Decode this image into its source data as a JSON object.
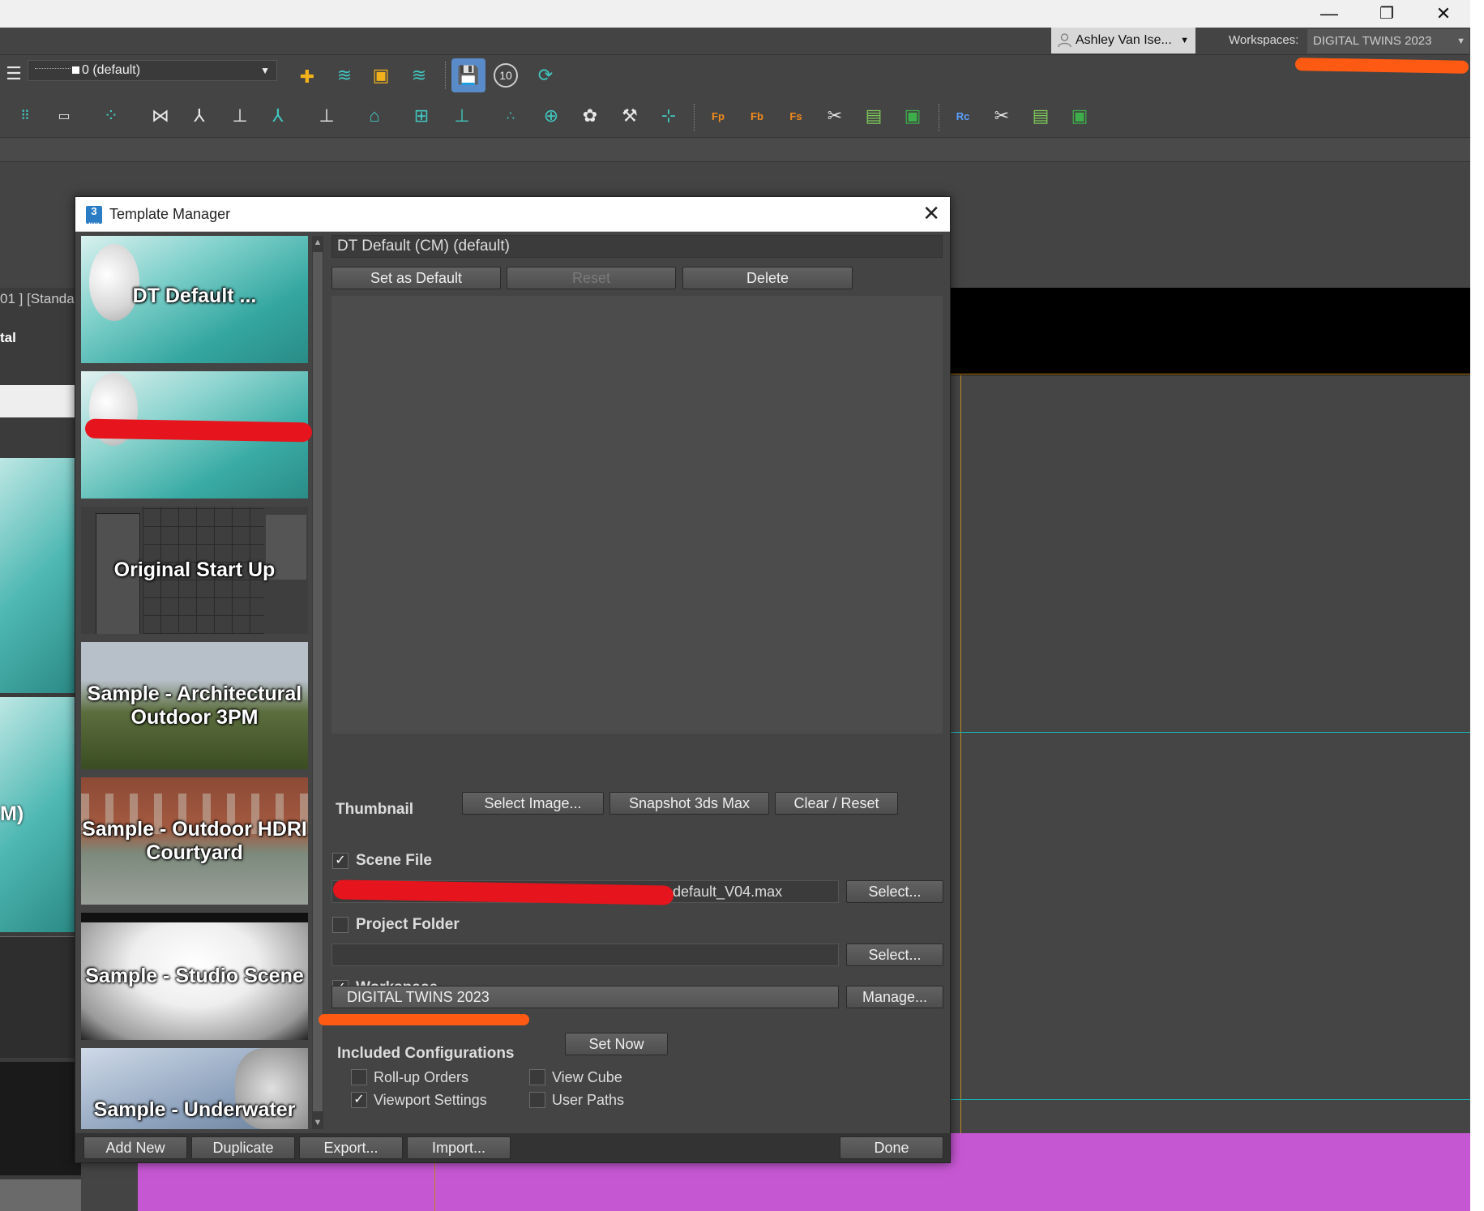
{
  "titlebar": {
    "minimize_icon": "minimize-icon",
    "restore_icon": "restore-icon",
    "close_icon": "close-icon"
  },
  "menubar": {
    "user_name": "Ashley Van Ise...",
    "workspaces_label": "Workspaces:",
    "workspace_value": "DIGITAL TWINS 2023"
  },
  "toolbar": {
    "layer_value": "0 (default)",
    "render_count": "10"
  },
  "toolbar_icons": [
    "layers-icon",
    "add-layer-icon",
    "layer-stack-icon",
    "select-layer-icon",
    "layer-manager-icon",
    "save-scene-icon",
    "counter-icon",
    "refresh-icon",
    "grid-icon",
    "ruler-icon",
    "dots-icon",
    "bone-icon",
    "biped-icon",
    "ik-icon",
    "spring-icon",
    "helper-icon",
    "constraint-icon",
    "mirror-icon",
    "align-icon",
    "particle-icon",
    "target-icon",
    "paint-icon",
    "tools-icon",
    "flow-icon",
    "fp-icon",
    "fb-icon",
    "fs-icon",
    "x-tool-icon",
    "table-icon",
    "green-panel-icon",
    "rc-icon",
    "x-tool2-icon",
    "table2-icon",
    "green-panel2-icon"
  ],
  "background": {
    "viewport_label_1": "01 ] [Standa",
    "viewport_label_2": "tal",
    "viewport_label_3": "M)"
  },
  "dialog": {
    "title": "Template Manager",
    "template_name": "DT Default (CM) (default)",
    "set_default_label": "Set as Default",
    "reset_label": "Reset",
    "delete_label": "Delete",
    "thumbnail_label": "Thumbnail",
    "select_image_label": "Select Image...",
    "snapshot_label": "Snapshot 3ds Max",
    "clear_reset_label": "Clear / Reset",
    "scene_file_label": "Scene File",
    "scene_file_value": "_default_V04.max",
    "scene_select_label": "Select...",
    "project_folder_label": "Project Folder",
    "project_folder_value": "",
    "project_select_label": "Select...",
    "workspace_label": "Workspace",
    "workspace_value": "DIGITAL TWINS 2023",
    "manage_label": "Manage...",
    "included_label": "Included Configurations",
    "set_now_label": "Set Now",
    "config_rollup": "Roll-up Orders",
    "config_viewcube": "View Cube",
    "config_viewport": "Viewport Settings",
    "config_userpaths": "User Paths",
    "add_new_label": "Add New",
    "duplicate_label": "Duplicate",
    "export_label": "Export...",
    "import_label": "Import...",
    "done_label": "Done",
    "checkmark": "✓"
  },
  "templates": [
    {
      "label": "DT Default ..."
    },
    {
      "label": ""
    },
    {
      "label": "Original Start Up"
    },
    {
      "label": "Sample - Architectural Outdoor 3PM"
    },
    {
      "label": "Sample - Outdoor HDRI Courtyard"
    },
    {
      "label": "Sample - Studio Scene"
    },
    {
      "label": "Sample - Underwater"
    }
  ],
  "checkboxes": {
    "scene_file": true,
    "project_folder": false,
    "workspace": true,
    "rollup_orders": false,
    "view_cube": false,
    "viewport_settings": true,
    "user_paths": false
  },
  "colors": {
    "accent_select": "#1c2fe6",
    "redaction": "#e6141c",
    "highlight": "#ff5a14",
    "viewport_purple": "#c657d3"
  }
}
